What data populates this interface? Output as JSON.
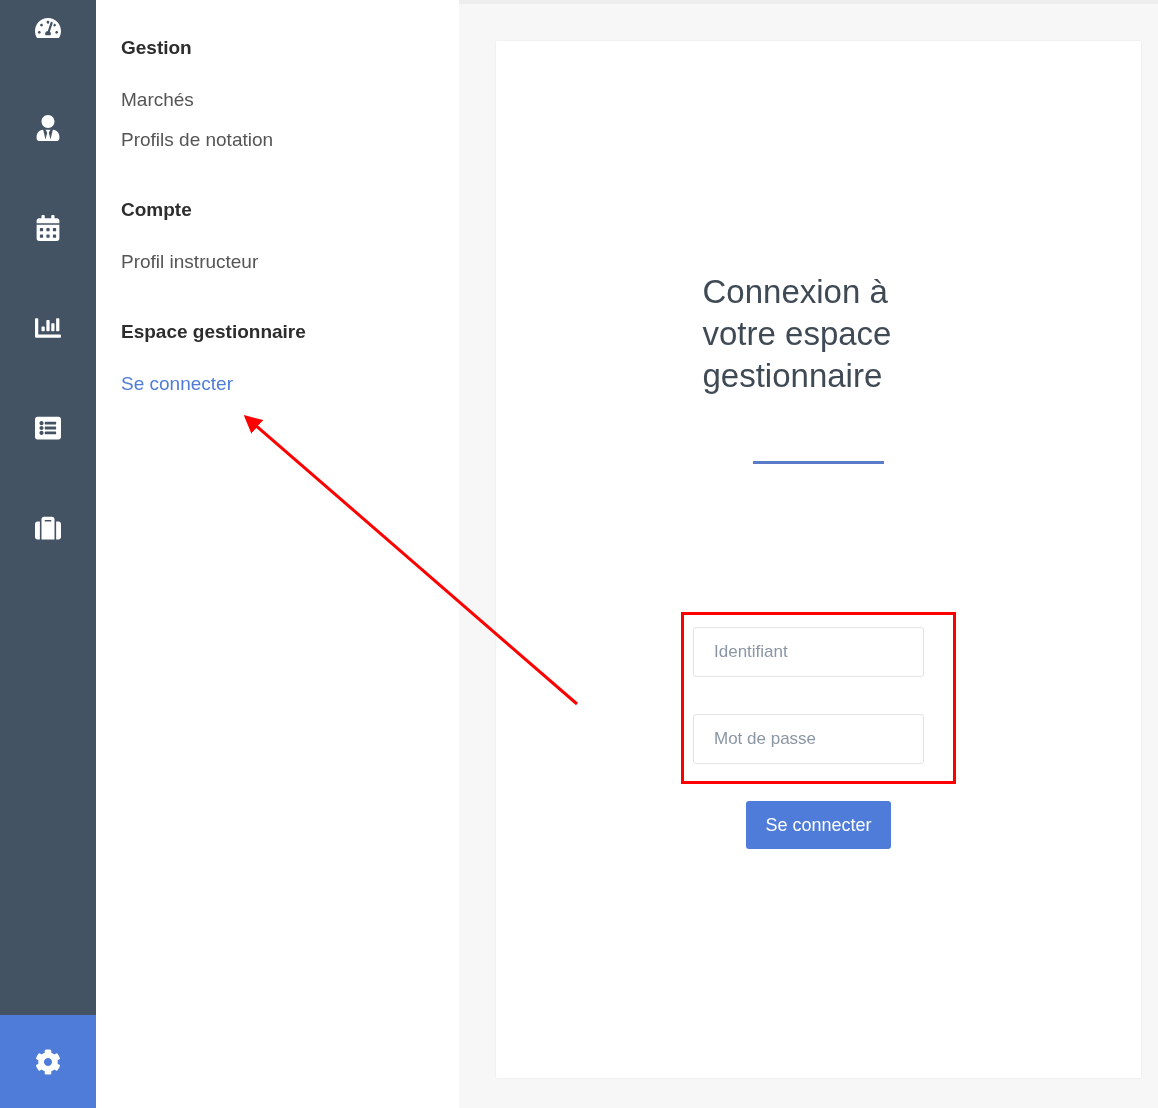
{
  "rail": [
    {
      "selected": false
    },
    {
      "selected": false
    },
    {
      "selected": false
    },
    {
      "selected": false
    },
    {
      "selected": false
    },
    {
      "selected": false
    },
    {
      "selected": true
    }
  ],
  "menu": [
    {
      "heading": "Gestion",
      "items": [
        {
          "label": "Marchés",
          "selected": false
        },
        {
          "label": "Profils de notation",
          "selected": false
        }
      ]
    },
    {
      "heading": "Compte",
      "items": [
        {
          "label": "Profil instructeur",
          "selected": false
        }
      ]
    },
    {
      "heading": "Espace gestionnaire",
      "items": [
        {
          "label": "Se connecter",
          "selected": true
        }
      ]
    }
  ],
  "login": {
    "title": "Connexion à votre espace gestionnaire",
    "fields": [
      {
        "placeholder": "Identifiant"
      },
      {
        "placeholder": "Mot de passe"
      }
    ],
    "button": "Se connecter"
  }
}
